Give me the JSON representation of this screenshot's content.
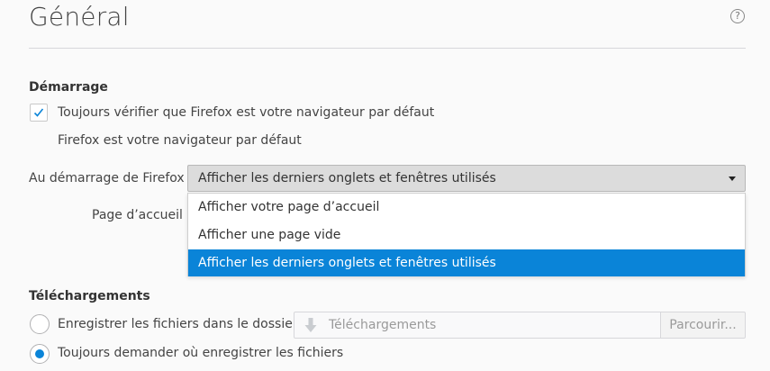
{
  "header": {
    "title": "Général",
    "help_icon_glyph": "?"
  },
  "startup": {
    "section_title": "Démarrage",
    "default_check_label": "Toujours vérifier que Firefox est votre navigateur par défaut",
    "default_check_checked": true,
    "default_status": "Firefox est votre navigateur par défaut",
    "on_startup_label": "Au démarrage de Firefox :",
    "on_startup_selected": "Afficher les derniers onglets et fenêtres utilisés",
    "homepage_label": "Page d’accueil :",
    "dropdown_options": [
      {
        "label": "Afficher votre page d’accueil",
        "selected": false
      },
      {
        "label": "Afficher une page vide",
        "selected": false
      },
      {
        "label": "Afficher les derniers onglets et fenêtres utilisés",
        "selected": true
      }
    ]
  },
  "downloads": {
    "section_title": "Téléchargements",
    "save_to_label": "Enregistrer les fichiers dans le dossier",
    "save_to_checked": false,
    "folder_value": "Téléchargements",
    "browse_label": "Parcourir...",
    "always_ask_label": "Toujours demander où enregistrer les fichiers",
    "always_ask_checked": true
  },
  "colors": {
    "accent": "#0a84d8",
    "background": "#fafafa"
  },
  "icons": {
    "help": "help-circle-icon",
    "check": "checkmark-icon",
    "dropdown": "chevron-down-icon",
    "download": "download-arrow-icon"
  }
}
